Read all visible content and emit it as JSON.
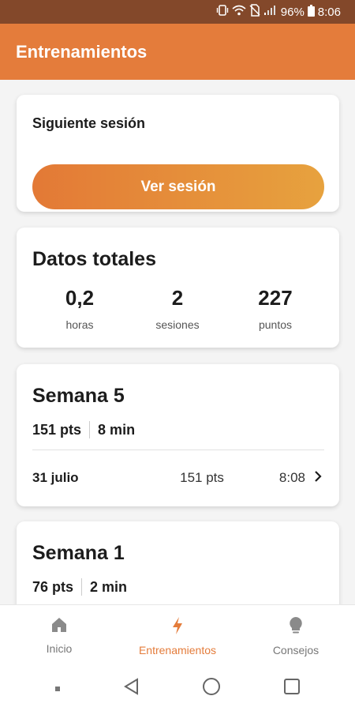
{
  "status_bar": {
    "battery": "96%",
    "time": "8:06",
    "icons": [
      "vibrate-icon",
      "wifi-icon",
      "no-sim-icon",
      "signal-icon",
      "battery-icon"
    ]
  },
  "app_bar": {
    "title": "Entrenamientos"
  },
  "next_session": {
    "title": "Siguiente sesión",
    "button_label": "Ver sesión"
  },
  "totals": {
    "title": "Datos totales",
    "stats": [
      {
        "value": "0,2",
        "label": "horas"
      },
      {
        "value": "2",
        "label": "sesiones"
      },
      {
        "value": "227",
        "label": "puntos"
      }
    ]
  },
  "weeks": [
    {
      "title": "Semana 5",
      "points": "151 pts",
      "duration": "8 min",
      "sessions": [
        {
          "date": "31 julio",
          "points": "151 pts",
          "time": "8:08"
        }
      ]
    },
    {
      "title": "Semana 1",
      "points": "76 pts",
      "duration": "2 min"
    }
  ],
  "bottom_nav": {
    "items": [
      {
        "label": "Inicio",
        "icon": "home-icon",
        "active": false
      },
      {
        "label": "Entrenamientos",
        "icon": "bolt-icon",
        "active": true
      },
      {
        "label": "Consejos",
        "icon": "lightbulb-icon",
        "active": false
      }
    ]
  },
  "colors": {
    "accent": "#e47c3b",
    "status_bar": "#83482a",
    "background": "#f4f4f4"
  },
  "system_nav": {
    "icons": [
      "recents-dot-icon",
      "back-icon",
      "home-circle-icon",
      "overview-square-icon"
    ]
  }
}
